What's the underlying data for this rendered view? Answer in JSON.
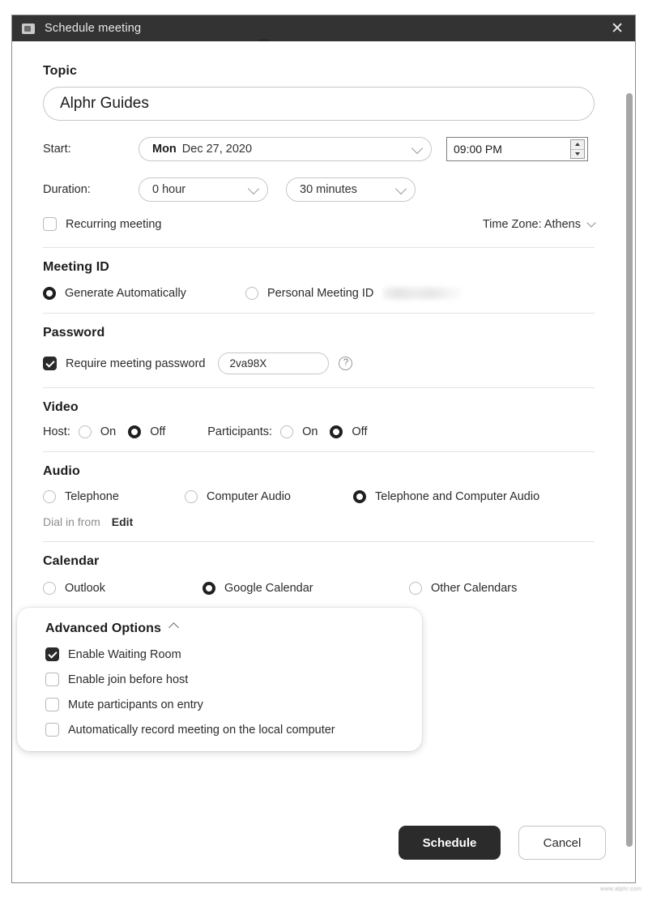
{
  "window": {
    "title": "Schedule meeting",
    "icon": "video-camera-icon",
    "close_label": "✕",
    "accent_dark": "#2b2b2b",
    "titlebar_bg": "#333333"
  },
  "topic": {
    "label": "Topic",
    "value": "Alphr Guides",
    "placeholder": "Topic"
  },
  "start": {
    "label": "Start:",
    "day": "Mon",
    "date": "Dec 27, 2020",
    "time": "09:00 PM"
  },
  "duration": {
    "label": "Duration:",
    "hours": "0 hour",
    "minutes": "30 minutes"
  },
  "recurring": {
    "label": "Recurring meeting",
    "checked": false
  },
  "timezone": {
    "label": "Time Zone: Athens"
  },
  "meeting_id": {
    "title": "Meeting ID",
    "options": [
      {
        "label": "Generate Automatically",
        "selected": true
      },
      {
        "label": "Personal Meeting ID",
        "selected": false,
        "redacted_value": true
      }
    ]
  },
  "password": {
    "title": "Password",
    "require_label": "Require meeting password",
    "require_checked": true,
    "value": "2va98X",
    "placeholder": "Password",
    "help_icon": "question-mark-icon",
    "help_label": "?"
  },
  "video": {
    "title": "Video",
    "groups": [
      {
        "label": "Host:",
        "options": [
          {
            "label": "On",
            "selected": false
          },
          {
            "label": "Off",
            "selected": true
          }
        ]
      },
      {
        "label": "Participants:",
        "options": [
          {
            "label": "On",
            "selected": false
          },
          {
            "label": "Off",
            "selected": true
          }
        ]
      }
    ]
  },
  "audio": {
    "title": "Audio",
    "options": [
      {
        "label": "Telephone",
        "selected": false
      },
      {
        "label": "Computer Audio",
        "selected": false
      },
      {
        "label": "Telephone and Computer Audio",
        "selected": true
      }
    ],
    "dial_in_label": "Dial in from",
    "edit_label": "Edit"
  },
  "calendar": {
    "title": "Calendar",
    "options": [
      {
        "label": "Outlook",
        "selected": false
      },
      {
        "label": "Google Calendar",
        "selected": true
      },
      {
        "label": "Other Calendars",
        "selected": false
      }
    ]
  },
  "advanced": {
    "title": "Advanced Options",
    "collapse_icon": "chevron-up-icon",
    "items": [
      {
        "label": "Enable Waiting Room",
        "checked": true
      },
      {
        "label": "Enable join before host",
        "checked": false
      },
      {
        "label": "Mute participants on entry",
        "checked": false
      },
      {
        "label": "Automatically record meeting on the local computer",
        "checked": false
      }
    ]
  },
  "footer": {
    "schedule_label": "Schedule",
    "cancel_label": "Cancel"
  },
  "watermark": "www.alphr.com"
}
